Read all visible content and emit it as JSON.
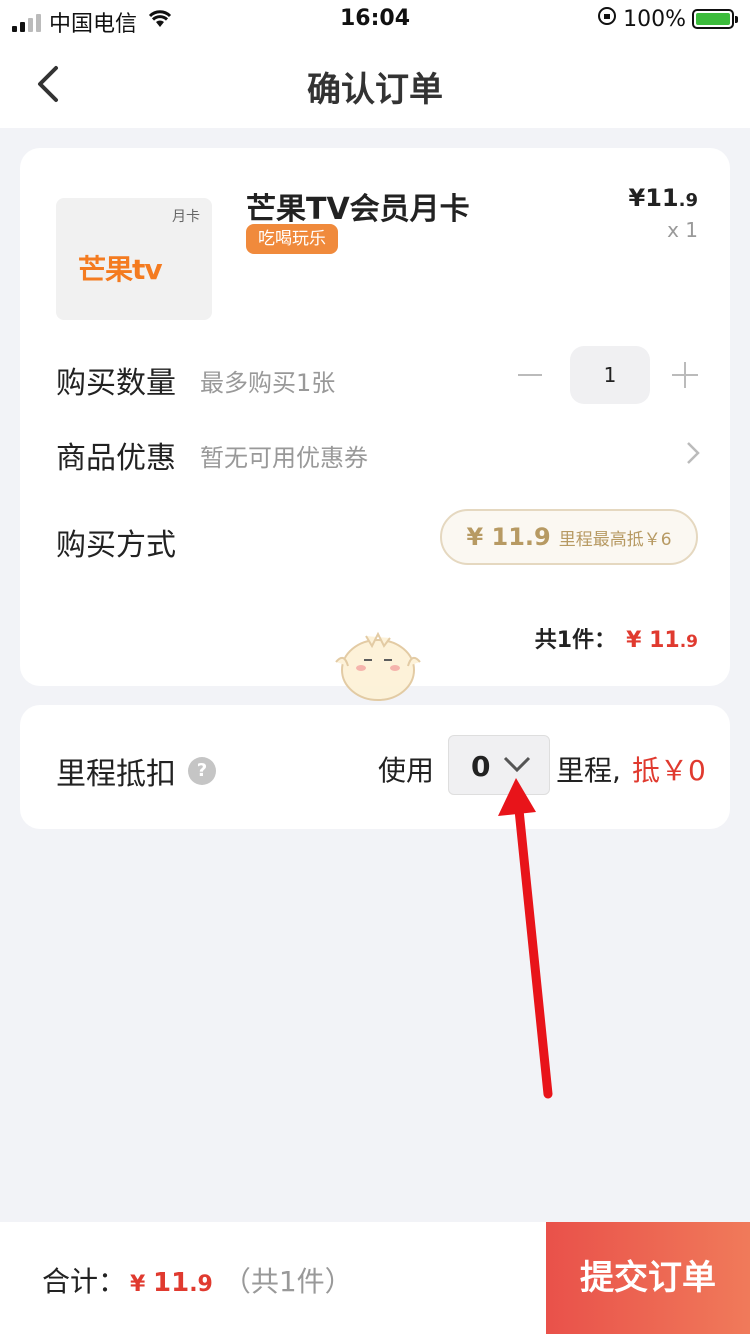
{
  "status_bar": {
    "carrier": "中国电信",
    "time": "16:04",
    "battery": "100%"
  },
  "nav": {
    "title": "确认订单"
  },
  "product": {
    "thumb_tag": "月卡",
    "thumb_logo": "芒果tv",
    "name": "芒果TV会员月卡",
    "badge": "吃喝玩乐",
    "price_symbol": "¥",
    "price_int": "11",
    "price_dec": ".9",
    "quantity_label": "x 1"
  },
  "purchase_qty": {
    "label": "购买数量",
    "hint": "最多购买1张",
    "value": "1"
  },
  "coupon": {
    "label": "商品优惠",
    "hint": "暂无可用优惠券"
  },
  "pay_method": {
    "label": "购买方式",
    "price": "¥ 11.9",
    "mileage_hint": "里程最高抵￥6"
  },
  "summary": {
    "label": "共1件：",
    "symbol": "¥",
    "amount_int": "11",
    "amount_dec": ".9"
  },
  "mileage": {
    "label": "里程抵扣",
    "help": "?",
    "use": "使用",
    "selected": "0",
    "unit": "里程,",
    "deduct": "抵￥0"
  },
  "bottom": {
    "total_label": "合计：",
    "symbol": "¥",
    "amount_int": "11",
    "amount_dec": ".9",
    "count": "（共1件）",
    "submit": "提交订单"
  },
  "colors": {
    "accent": "#e03a2f",
    "badge": "#f08a3c",
    "gold": "#b79a63",
    "background": "#f2f3f7"
  }
}
